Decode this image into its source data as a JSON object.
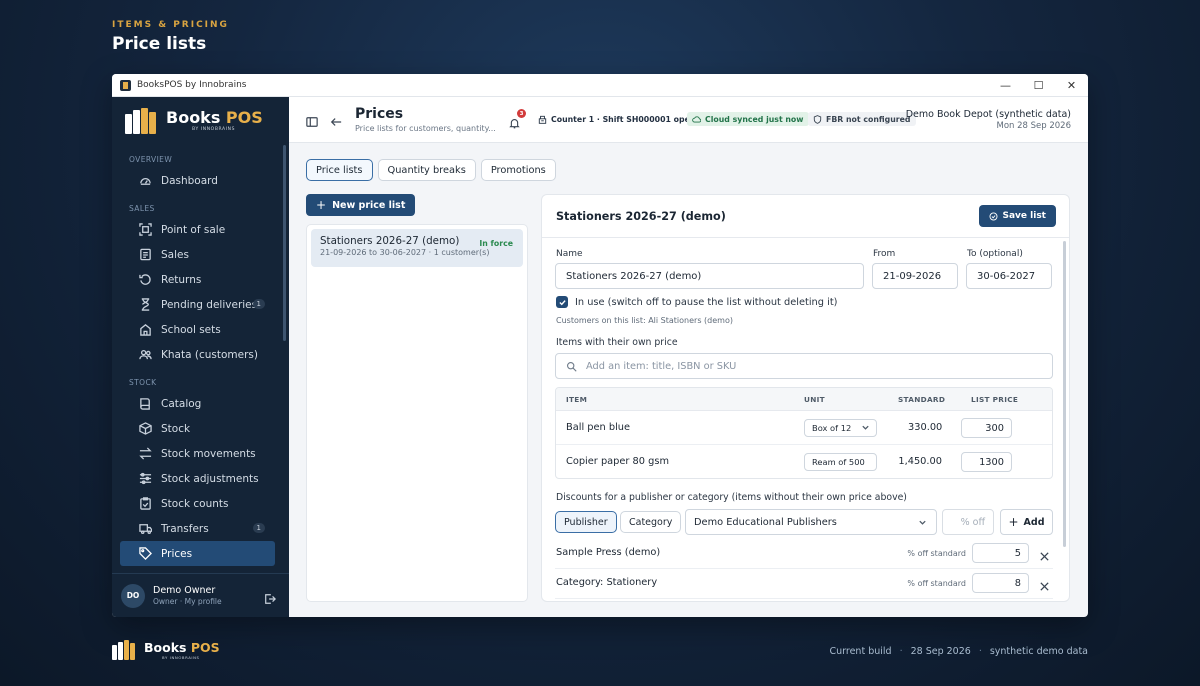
{
  "page": {
    "kicker": "ITEMS & PRICING",
    "heading": "Price lists"
  },
  "window": {
    "title": "BooksPOS by Innobrains",
    "controls": {
      "minimize": "—",
      "maximize": "☐",
      "close": "✕"
    }
  },
  "brand": {
    "name_primary": "Books",
    "name_accent": "POS",
    "sub": "BY INNOBRAINS"
  },
  "sidebar": {
    "sections": [
      {
        "label": "OVERVIEW",
        "items": [
          {
            "label": "Dashboard",
            "icon": "gauge-icon"
          }
        ]
      },
      {
        "label": "SALES",
        "items": [
          {
            "label": "Point of sale",
            "icon": "scan-icon"
          },
          {
            "label": "Sales",
            "icon": "list-icon"
          },
          {
            "label": "Returns",
            "icon": "return-icon"
          },
          {
            "label": "Pending deliveries",
            "icon": "hourglass-icon",
            "count": "1"
          },
          {
            "label": "School sets",
            "icon": "school-icon"
          },
          {
            "label": "Khata (customers)",
            "icon": "users-icon"
          }
        ]
      },
      {
        "label": "STOCK",
        "items": [
          {
            "label": "Catalog",
            "icon": "book-icon"
          },
          {
            "label": "Stock",
            "icon": "box-icon"
          },
          {
            "label": "Stock movements",
            "icon": "arrows-icon"
          },
          {
            "label": "Stock adjustments",
            "icon": "sliders-icon"
          },
          {
            "label": "Stock counts",
            "icon": "clipboard-icon"
          },
          {
            "label": "Transfers",
            "icon": "truck-icon",
            "count": "1"
          },
          {
            "label": "Prices",
            "icon": "tag-icon",
            "active": true
          }
        ]
      }
    ],
    "user": {
      "initials": "DO",
      "name": "Demo Owner",
      "role": "Owner · My profile"
    }
  },
  "header": {
    "title": "Prices",
    "subtitle": "Price lists for customers, quantity...",
    "notifications": "3",
    "counter": "Counter 1 · Shift SH000001 open",
    "cloud": "Cloud synced just now",
    "fbr": "FBR not configured",
    "store": "Demo Book Depot (synthetic data)",
    "date": "Mon 28 Sep 2026"
  },
  "tabs": [
    "Price lists",
    "Quantity breaks",
    "Promotions"
  ],
  "new_button": "New price list",
  "list": [
    {
      "name": "Stationers 2026-27 (demo)",
      "meta": "21-09-2026 to 30-06-2027 · 1 customer(s)",
      "status": "In force"
    }
  ],
  "editor": {
    "title": "Stationers 2026-27 (demo)",
    "save": "Save list",
    "labels": {
      "name": "Name",
      "from": "From",
      "to": "To (optional)"
    },
    "values": {
      "name": "Stationers 2026-27 (demo)",
      "from": "21-09-2026",
      "to": "30-06-2027"
    },
    "in_use": "In use (switch off to pause the list without deleting it)",
    "customers": "Customers on this list: Ali Stationers (demo)",
    "items_label": "Items with their own price",
    "search_placeholder": "Add an item: title, ISBN or SKU",
    "table": {
      "headers": {
        "item": "ITEM",
        "unit": "UNIT",
        "standard": "STANDARD",
        "list_price": "LIST PRICE"
      },
      "rows": [
        {
          "item": "Ball pen blue",
          "unit": "Box of 12",
          "standard": "330.00",
          "list_price": "300"
        },
        {
          "item": "Copier paper 80 gsm",
          "unit": "Ream of 500",
          "standard": "1,450.00",
          "list_price": "1300"
        }
      ]
    },
    "discounts_label": "Discounts for a publisher or category (items without their own price above)",
    "seg": {
      "publisher": "Publisher",
      "category": "Category"
    },
    "publisher_value": "Demo Educational Publishers",
    "pct_placeholder": "% off",
    "add": "Add",
    "discounts": [
      {
        "name": "Sample Press (demo)",
        "unit": "% off standard",
        "value": "5"
      },
      {
        "name": "Category: Stationery",
        "unit": "% off standard",
        "value": "8"
      }
    ]
  },
  "footer": {
    "build_label": "Current build",
    "build_date": "28 Sep 2026",
    "data_note": "synthetic demo data"
  },
  "colors": {
    "sidebar": "#142437",
    "accent": "#234b76",
    "brand_gold": "#e8b04a",
    "success": "#2b8a4f"
  }
}
